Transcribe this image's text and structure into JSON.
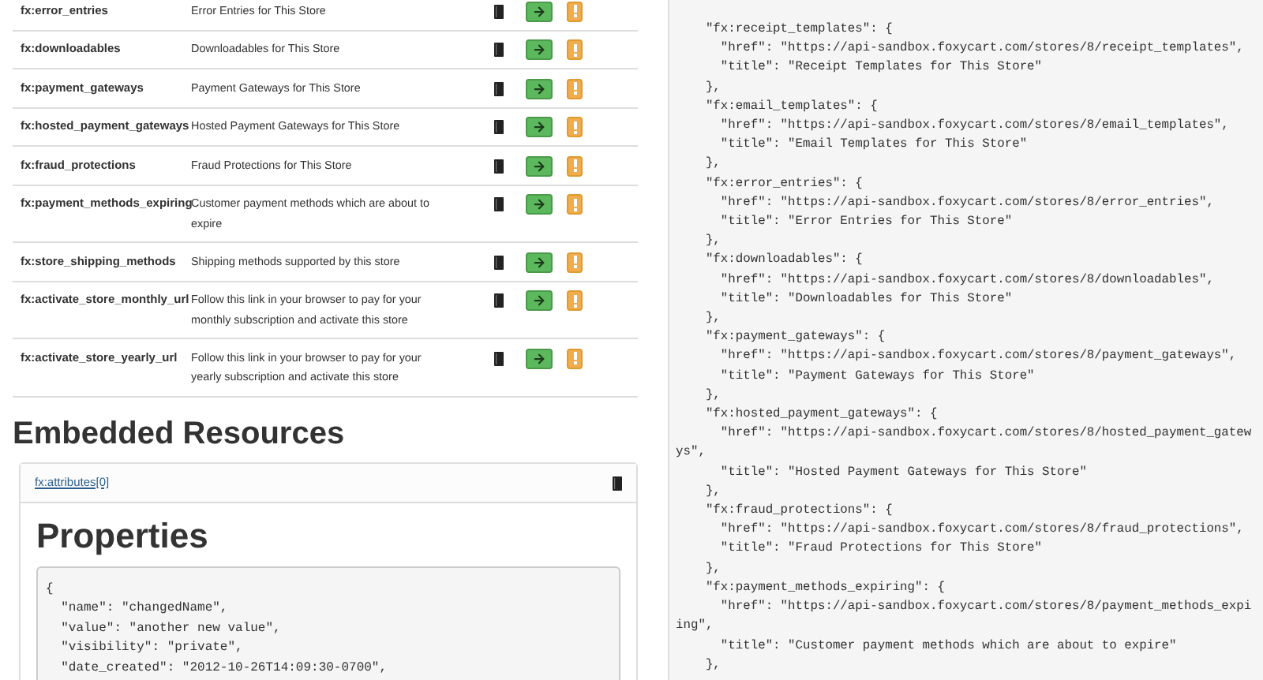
{
  "links": [
    {
      "rel": "fx:error_entries",
      "title": "Error Entries for This Store"
    },
    {
      "rel": "fx:downloadables",
      "title": "Downloadables for This Store"
    },
    {
      "rel": "fx:payment_gateways",
      "title": "Payment Gateways for This Store"
    },
    {
      "rel": "fx:hosted_payment_gateways",
      "title": "Hosted Payment Gateways for This Store"
    },
    {
      "rel": "fx:fraud_protections",
      "title": "Fraud Protections for This Store"
    },
    {
      "rel": "fx:payment_methods_expiring",
      "title": "Customer payment methods which are about to expire"
    },
    {
      "rel": "fx:store_shipping_methods",
      "title": "Shipping methods supported by this store"
    },
    {
      "rel": "fx:activate_store_monthly_url",
      "title": "Follow this link in your browser to pay for your monthly subscription and activate this store"
    },
    {
      "rel": "fx:activate_store_yearly_url",
      "title": "Follow this link in your browser to pay for your yearly subscription and activate this store"
    }
  ],
  "embedded": {
    "heading": "Embedded Resources",
    "resource_link": "fx:attributes[0]",
    "properties_heading": "Properties",
    "code_lines": [
      "{",
      "  \"name\": \"changedName\",",
      "  \"value\": \"another new value\",",
      "  \"visibility\": \"private\",",
      "  \"date_created\": \"2012-10-26T14:09:30-0700\","
    ]
  },
  "response_code_lines": [
    "    \"fx:receipt_templates\": {",
    "      \"href\": \"https://api-sandbox.foxycart.com/stores/8/receipt_templates\",",
    "      \"title\": \"Receipt Templates for This Store\"",
    "    },",
    "    \"fx:email_templates\": {",
    "      \"href\": \"https://api-sandbox.foxycart.com/stores/8/email_templates\",",
    "      \"title\": \"Email Templates for This Store\"",
    "    },",
    "    \"fx:error_entries\": {",
    "      \"href\": \"https://api-sandbox.foxycart.com/stores/8/error_entries\",",
    "      \"title\": \"Error Entries for This Store\"",
    "    },",
    "    \"fx:downloadables\": {",
    "      \"href\": \"https://api-sandbox.foxycart.com/stores/8/downloadables\",",
    "      \"title\": \"Downloadables for This Store\"",
    "    },",
    "    \"fx:payment_gateways\": {",
    "      \"href\": \"https://api-sandbox.foxycart.com/stores/8/payment_gateways\",",
    "      \"title\": \"Payment Gateways for This Store\"",
    "    },",
    "    \"fx:hosted_payment_gateways\": {",
    "      \"href\": \"https://api-sandbox.foxycart.com/stores/8/hosted_payment_gatew",
    "ys\",",
    "      \"title\": \"Hosted Payment Gateways for This Store\"",
    "    },",
    "    \"fx:fraud_protections\": {",
    "      \"href\": \"https://api-sandbox.foxycart.com/stores/8/fraud_protections\",",
    "      \"title\": \"Fraud Protections for This Store\"",
    "    },",
    "    \"fx:payment_methods_expiring\": {",
    "      \"href\": \"https://api-sandbox.foxycart.com/stores/8/payment_methods_expi",
    "ing\",",
    "      \"title\": \"Customer payment methods which are about to expire\"",
    "    },"
  ]
}
